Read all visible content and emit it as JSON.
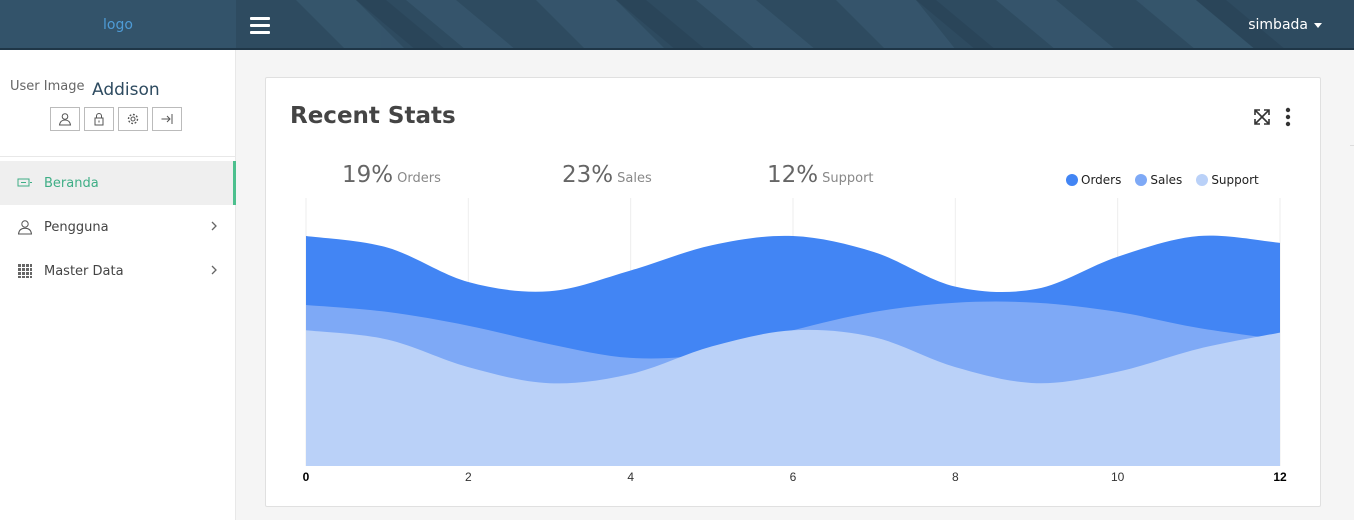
{
  "header": {
    "logo_text": "logo",
    "user_label": "simbada"
  },
  "sidebar": {
    "user_image_alt": "User Image",
    "user_name": "Addison",
    "actions": [
      {
        "icon": "user-icon"
      },
      {
        "icon": "lock-icon"
      },
      {
        "icon": "gear-icon"
      },
      {
        "icon": "logout-icon"
      }
    ],
    "items": [
      {
        "label": "Beranda",
        "icon": "dashboard-icon",
        "active": true
      },
      {
        "label": "Pengguna",
        "icon": "user-icon",
        "has_submenu": true
      },
      {
        "label": "Master Data",
        "icon": "grid-icon",
        "has_submenu": true
      }
    ]
  },
  "card": {
    "title": "Recent Stats",
    "stats": [
      {
        "percent": "19%",
        "label": "Orders"
      },
      {
        "percent": "23%",
        "label": "Sales"
      },
      {
        "percent": "12%",
        "label": "Support"
      }
    ]
  },
  "colors": {
    "orders": "#4285f4",
    "sales": "#7ea9f6",
    "support": "#bad1f8",
    "accent": "#3fae86",
    "topbar": "#2e4b60"
  },
  "chart_data": {
    "type": "area",
    "x": [
      0,
      1,
      2,
      3,
      4,
      5,
      6,
      7,
      8,
      9,
      10,
      11,
      12
    ],
    "xticks": [
      "0",
      "2",
      "4",
      "6",
      "8",
      "10",
      "12"
    ],
    "xlim": [
      0,
      12
    ],
    "ylim": [
      0,
      100
    ],
    "legend": "top-right",
    "grid": "vertical",
    "series": [
      {
        "name": "Orders",
        "color": "#4285f4",
        "values": [
          100,
          95,
          80,
          76,
          85,
          96,
          100,
          93,
          78,
          77,
          91,
          100,
          97
        ]
      },
      {
        "name": "Sales",
        "color": "#7ea9f6",
        "values": [
          70,
          67,
          61,
          53,
          47,
          49,
          59,
          67,
          71,
          71,
          67,
          60,
          55
        ]
      },
      {
        "name": "Support",
        "color": "#bad1f8",
        "values": [
          59,
          55,
          43,
          36,
          40,
          52,
          59,
          56,
          43,
          36,
          41,
          51,
          58
        ]
      }
    ]
  }
}
